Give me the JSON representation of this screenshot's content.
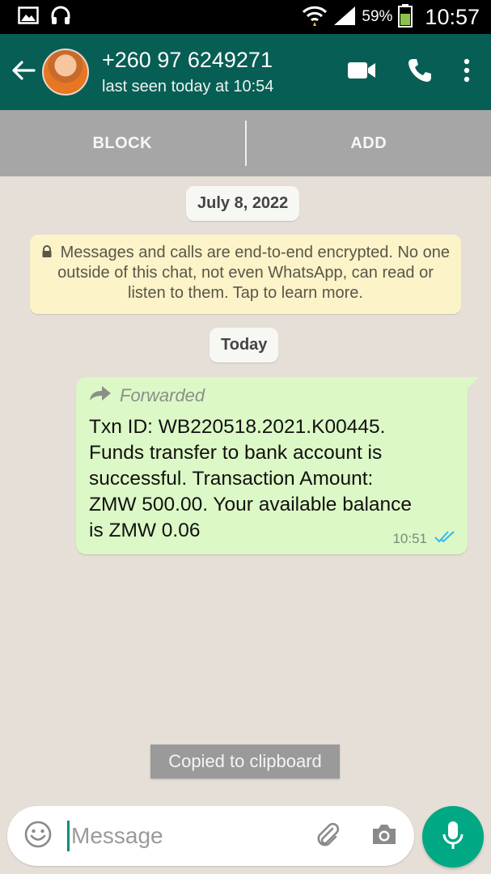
{
  "status_bar": {
    "battery": "59%",
    "time": "10:57",
    "icons": [
      "gallery-icon",
      "headphones-icon",
      "wifi-icon",
      "signal-icon",
      "battery-icon"
    ]
  },
  "header": {
    "contact_name": "+260 97 6249271",
    "last_seen": "last seen today at 10:54",
    "icons": [
      "back-arrow-icon",
      "video-call-icon",
      "phone-call-icon",
      "more-options-icon"
    ]
  },
  "actions": {
    "block": "BLOCK",
    "add": "ADD"
  },
  "chat": {
    "date_chip": "July 8, 2022",
    "encryption_notice": "Messages and calls are end-to-end encrypted. No one outside of this chat, not even WhatsApp, can read or listen to them. Tap to learn more.",
    "today_chip": "Today",
    "message": {
      "forwarded_label": "Forwarded",
      "text": "Txn ID: WB220518.2021.K00445.\nFunds transfer to bank account is\nsuccessful. Transaction Amount:\nZMW 500.00. Your available balance\nis ZMW 0.06",
      "time": "10:51",
      "status_icon": "double-check-read-icon"
    }
  },
  "toast": {
    "text": "Copied to clipboard"
  },
  "composer": {
    "placeholder": "Message",
    "icons": [
      "emoji-icon",
      "attach-icon",
      "camera-icon",
      "mic-icon"
    ]
  },
  "colors": {
    "header": "#075e54",
    "accent": "#00a884",
    "outgoing_bubble": "#dcf8c6",
    "encryption_bg": "#fcf3c9",
    "read_ticks": "#34b7f1"
  }
}
